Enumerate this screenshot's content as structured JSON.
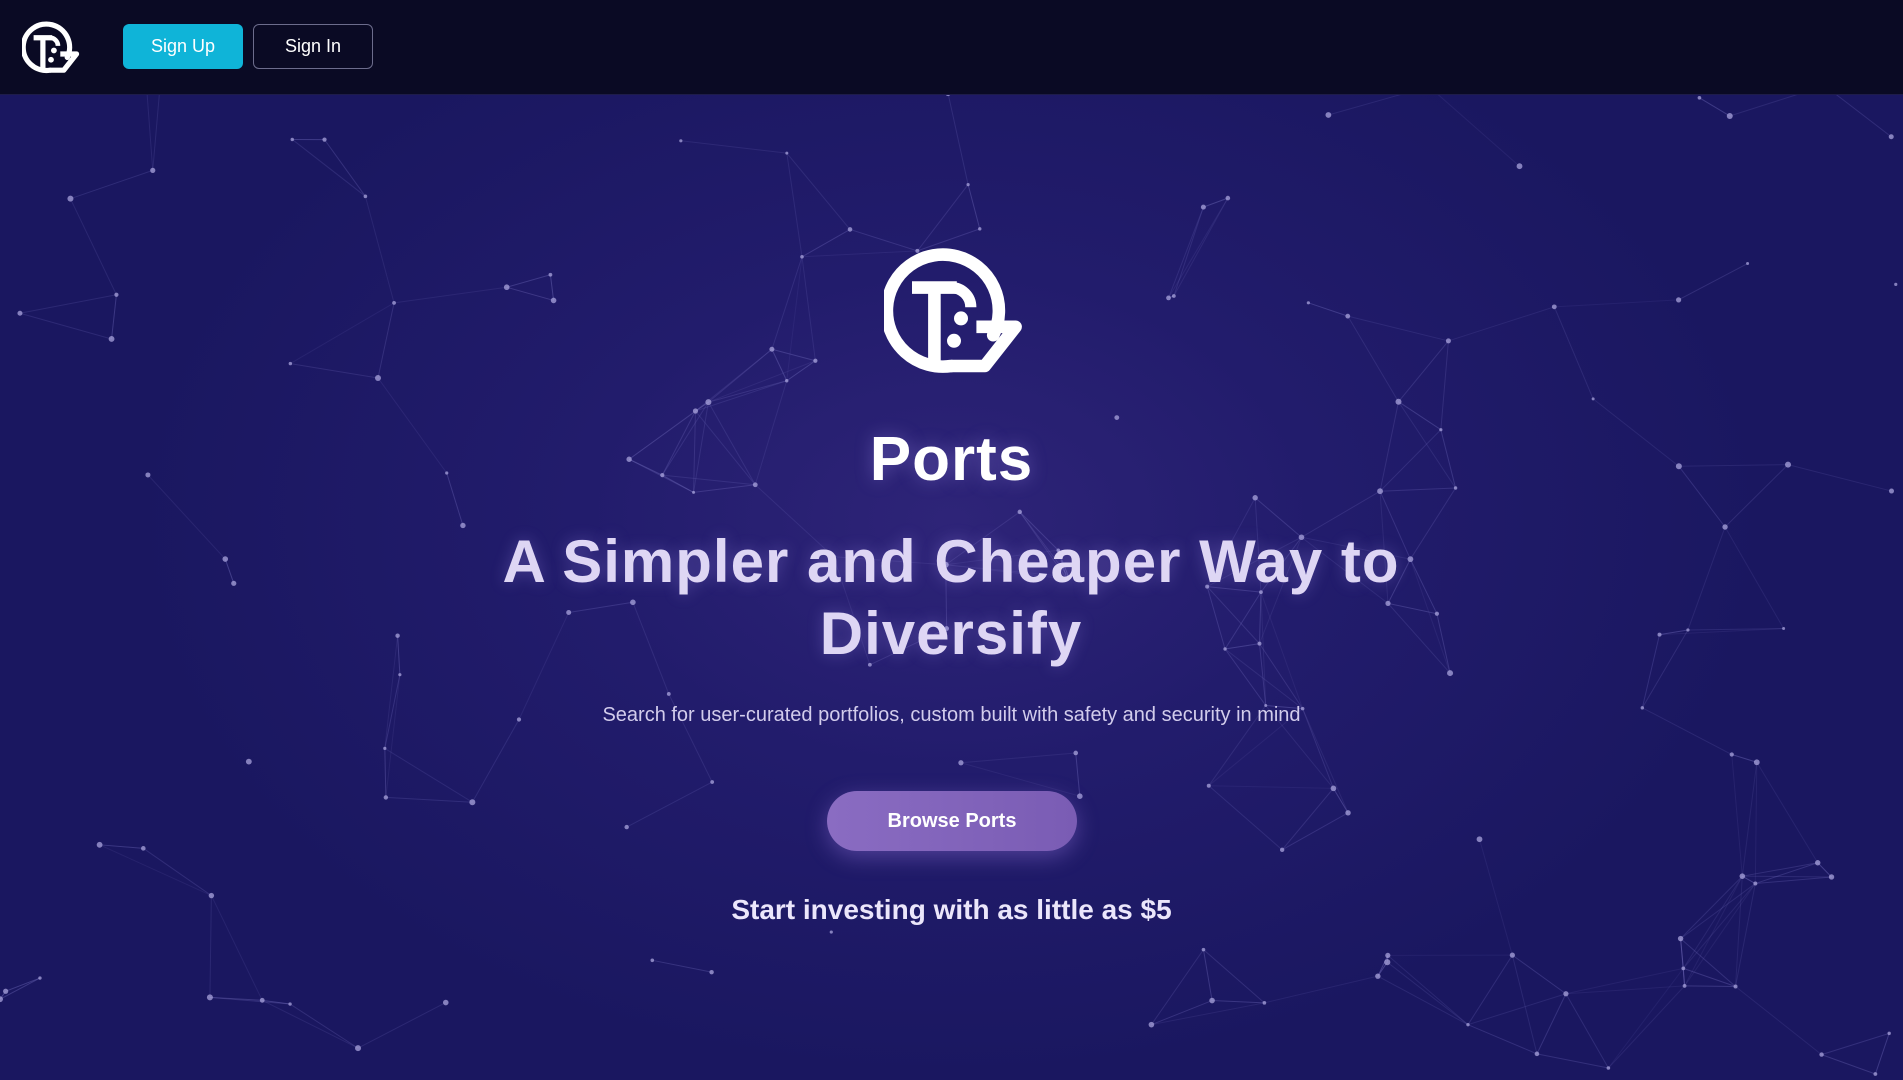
{
  "nav": {
    "logo_icon": "ports-logo-icon",
    "signup_label": "Sign Up",
    "signin_label": "Sign In"
  },
  "hero": {
    "logo_icon": "ports-logo-icon",
    "brand": "Ports",
    "headline": "A Simpler and Cheaper Way to Diversify",
    "subtitle": "Search for user-curated portfolios, custom built with safety and security in mind",
    "cta_label": "Browse Ports",
    "tagline": "Start investing with as little as $5"
  },
  "colors": {
    "background": "#1a1760",
    "topbar": "#0a0a24",
    "signup_button": "#0fb4d8",
    "browse_button": "#8a6cc2",
    "network_lines": "#6e68b8"
  }
}
